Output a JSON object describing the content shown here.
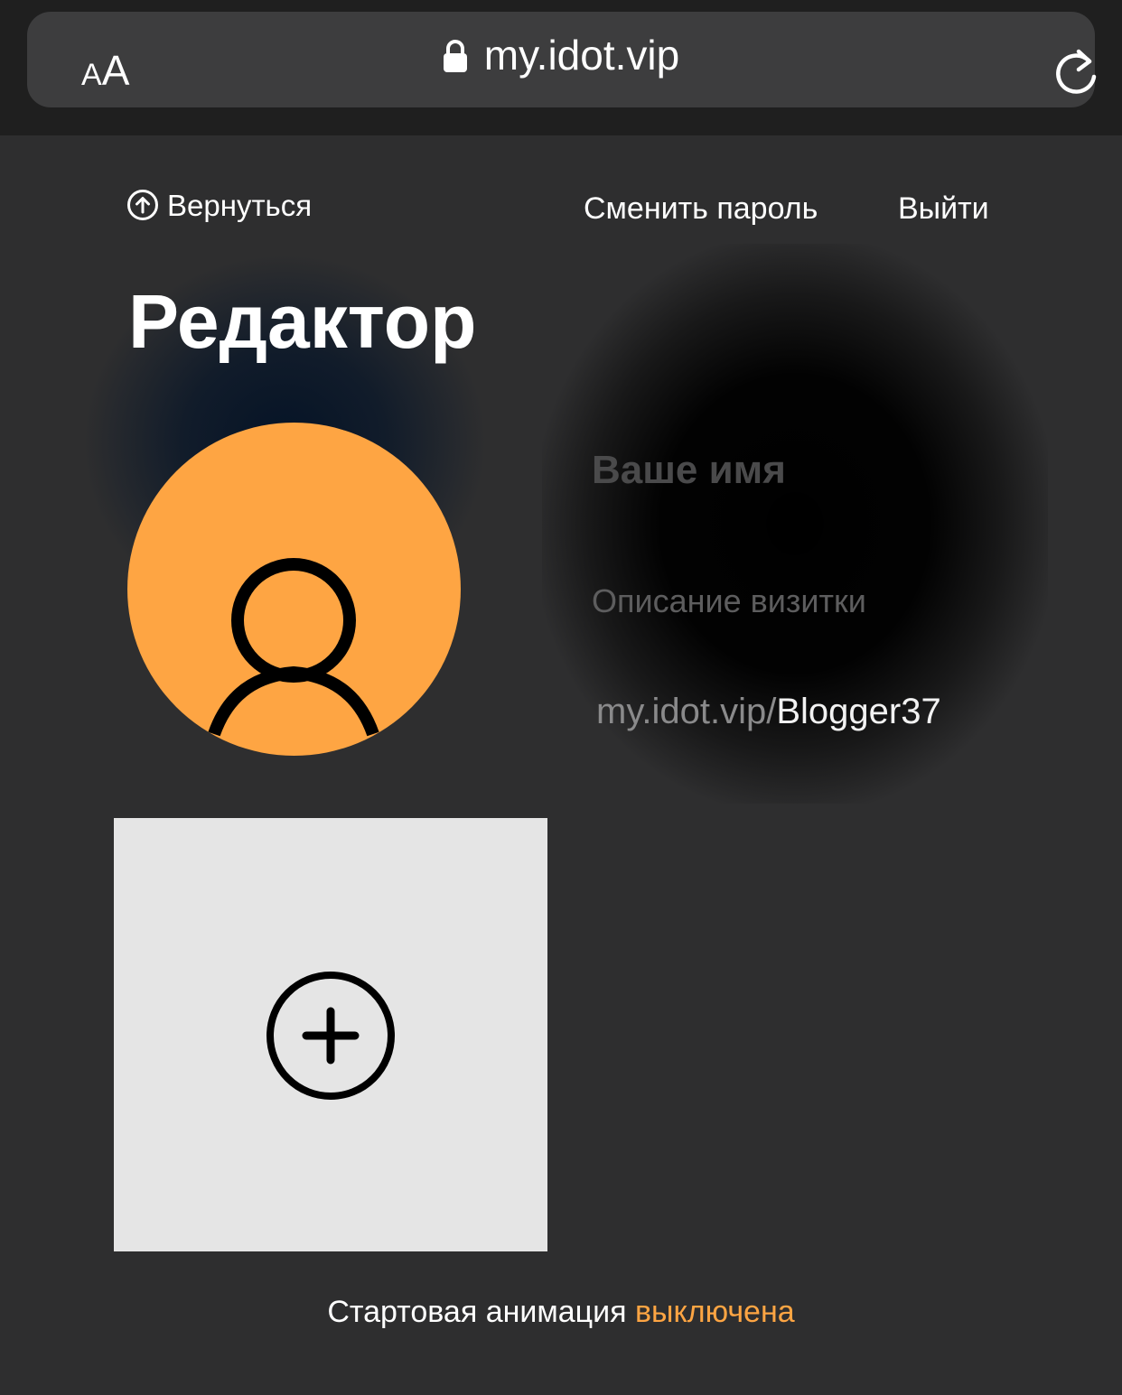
{
  "browser": {
    "aa_small": "A",
    "aa_big": "A",
    "url": "my.idot.vip",
    "icons": [
      "text-size-icon",
      "lock-icon",
      "reload-icon"
    ]
  },
  "header": {
    "back_label": "Вернуться",
    "change_password_label": "Сменить пароль",
    "logout_label": "Выйти"
  },
  "editor": {
    "title": "Редактор",
    "name_placeholder": "Ваше имя",
    "description_placeholder": "Описание визитки",
    "url_prefix": "my.idot.vip/",
    "url_slug": "Blogger37"
  },
  "footer": {
    "animation_label": "Стартовая анимация",
    "animation_state": "выключена"
  },
  "colors": {
    "background": "#2e2e2f",
    "accent": "#fea543",
    "add_block": "#e5e5e5"
  }
}
